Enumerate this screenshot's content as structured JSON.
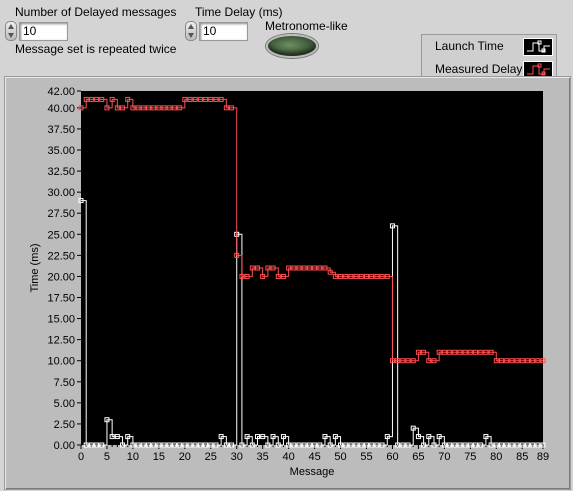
{
  "controls": {
    "num_delayed_label": "Number of Delayed messages",
    "num_delayed_value": "10",
    "repeat_note": "Message set is repeated twice",
    "time_delay_label": "Time Delay (ms)",
    "time_delay_value": "10",
    "metronome_label": "Metronome-like"
  },
  "legend": {
    "items": [
      "Launch Time",
      "Measured Delay"
    ]
  },
  "colors": {
    "launch": "#ffffff",
    "delay": "#ff5050",
    "plot_bg": "#000000"
  },
  "chart_data": {
    "type": "line",
    "xlabel": "Message",
    "ylabel": "Time (ms)",
    "xlim": [
      0,
      89
    ],
    "ylim": [
      0,
      42
    ],
    "x_ticks": [
      "0",
      "5",
      "10",
      "15",
      "20",
      "25",
      "30",
      "35",
      "40",
      "45",
      "50",
      "55",
      "60",
      "65",
      "70",
      "75",
      "80",
      "85",
      "89"
    ],
    "y_ticks": [
      "0.00",
      "2.50",
      "5.00",
      "7.50",
      "10.00",
      "12.50",
      "15.00",
      "17.50",
      "20.00",
      "22.50",
      "25.00",
      "27.50",
      "30.00",
      "32.50",
      "35.00",
      "37.50",
      "40.00",
      "42.00"
    ],
    "series": [
      {
        "name": "Launch Time",
        "step": true,
        "x": [
          0,
          1,
          2,
          3,
          4,
          5,
          6,
          7,
          8,
          9,
          10,
          11,
          12,
          13,
          14,
          15,
          16,
          17,
          18,
          19,
          20,
          21,
          22,
          23,
          24,
          25,
          26,
          27,
          28,
          29,
          30,
          31,
          32,
          33,
          34,
          35,
          36,
          37,
          38,
          39,
          40,
          41,
          42,
          43,
          44,
          45,
          46,
          47,
          48,
          49,
          50,
          51,
          52,
          53,
          54,
          55,
          56,
          57,
          58,
          59,
          60,
          61,
          62,
          63,
          64,
          65,
          66,
          67,
          68,
          69,
          70,
          71,
          72,
          73,
          74,
          75,
          76,
          77,
          78,
          79,
          80,
          81,
          82,
          83,
          84,
          85,
          86,
          87,
          88,
          89
        ],
        "y": [
          29,
          0,
          0,
          0,
          0,
          3,
          1,
          1,
          0,
          1,
          0,
          0,
          0,
          0,
          0,
          0,
          0,
          0,
          0,
          0,
          0,
          0,
          0,
          0,
          0,
          0,
          0,
          1,
          0,
          0,
          25,
          0,
          1,
          0,
          1,
          1,
          0,
          1,
          0,
          1,
          0,
          0,
          0,
          0,
          0,
          0,
          0,
          1,
          0,
          1,
          0,
          0,
          0,
          0,
          0,
          0,
          0,
          0,
          0,
          1,
          26,
          0,
          0,
          0,
          2,
          1,
          0,
          1,
          0,
          1,
          0,
          0,
          0,
          0,
          0,
          0,
          0,
          0,
          1,
          0,
          0,
          0,
          0,
          0,
          0,
          0,
          0,
          0,
          0,
          0
        ]
      },
      {
        "name": "Measured Delay",
        "step": true,
        "x": [
          0,
          1,
          2,
          3,
          4,
          5,
          6,
          7,
          8,
          9,
          10,
          11,
          12,
          13,
          14,
          15,
          16,
          17,
          18,
          19,
          20,
          21,
          22,
          23,
          24,
          25,
          26,
          27,
          28,
          29,
          30,
          31,
          32,
          33,
          34,
          35,
          36,
          37,
          38,
          39,
          40,
          41,
          42,
          43,
          44,
          45,
          46,
          47,
          48,
          49,
          50,
          51,
          52,
          53,
          54,
          55,
          56,
          57,
          58,
          59,
          60,
          61,
          62,
          63,
          64,
          65,
          66,
          67,
          68,
          69,
          70,
          71,
          72,
          73,
          74,
          75,
          76,
          77,
          78,
          79,
          80,
          81,
          82,
          83,
          84,
          85,
          86,
          87,
          88,
          89
        ],
        "y": [
          40,
          41,
          41,
          41,
          41,
          40,
          41,
          40,
          40,
          41,
          40,
          40,
          40,
          40,
          40,
          40,
          40,
          40,
          40,
          40,
          41,
          41,
          41,
          41,
          41,
          41,
          41,
          41,
          40,
          40,
          22.5,
          20,
          20,
          21,
          21,
          20,
          21,
          21,
          20,
          20,
          21,
          21,
          21,
          21,
          21,
          21,
          21,
          21,
          20.5,
          20,
          20,
          20,
          20,
          20,
          20,
          20,
          20,
          20,
          20,
          20,
          10,
          10,
          10,
          10,
          10,
          11,
          11,
          10,
          10,
          11,
          11,
          11,
          11,
          11,
          11,
          11,
          11,
          11,
          11,
          11,
          10,
          10,
          10,
          10,
          10,
          10,
          10,
          10,
          10,
          10
        ]
      }
    ]
  }
}
